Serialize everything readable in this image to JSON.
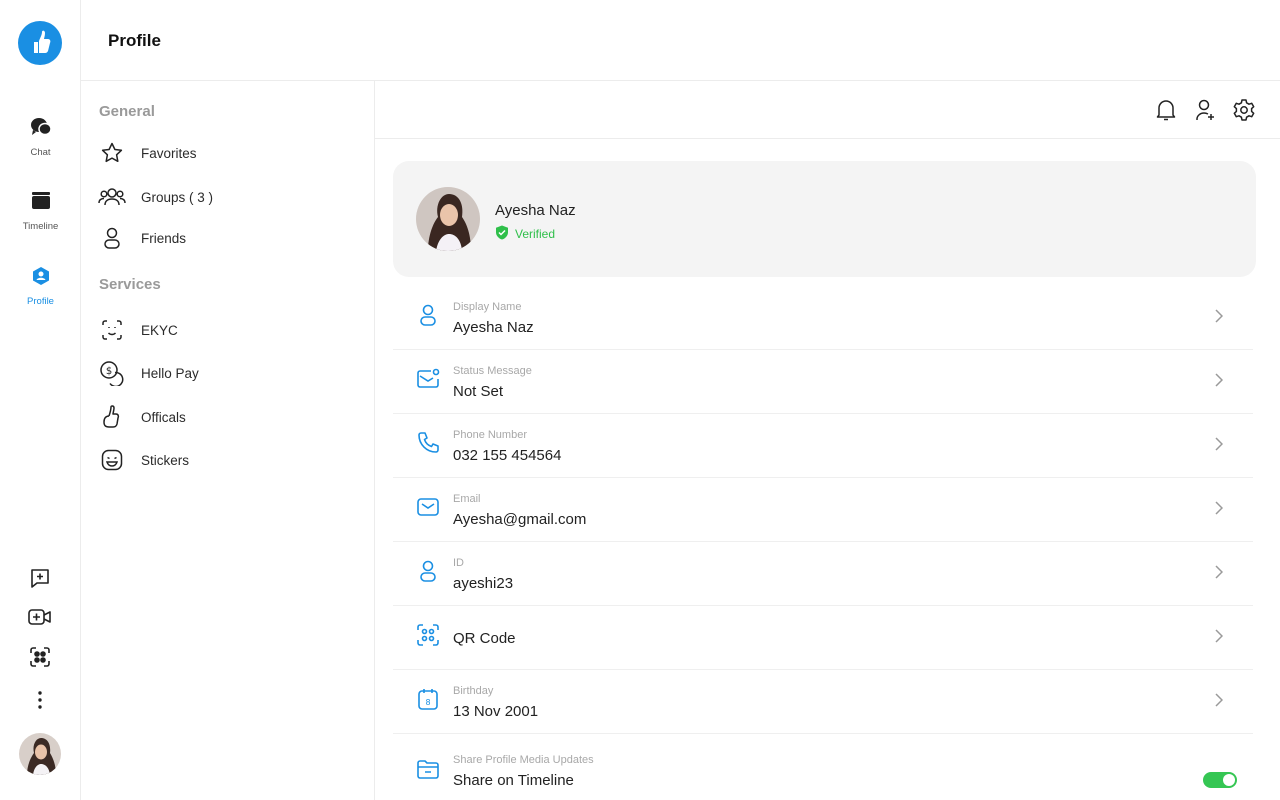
{
  "header": {
    "title": "Profile"
  },
  "rail": {
    "items": [
      {
        "label": "Chat",
        "icon": "chat-bubbles-icon"
      },
      {
        "label": "Timeline",
        "icon": "timeline-icon"
      },
      {
        "label": "Profile",
        "icon": "profile-icon",
        "active": true
      }
    ],
    "tools": [
      "add-chat-icon",
      "add-video-icon",
      "scan-icon",
      "more-vertical-icon"
    ]
  },
  "menu": {
    "general_title": "General",
    "general": [
      {
        "label": "Favorites",
        "icon": "star-icon"
      },
      {
        "label": "Groups ( 3 )",
        "icon": "groups-icon"
      },
      {
        "label": "Friends",
        "icon": "friend-icon"
      }
    ],
    "services_title": "Services",
    "services": [
      {
        "label": "EKYC",
        "icon": "face-scan-icon"
      },
      {
        "label": "Hello Pay",
        "icon": "coins-icon"
      },
      {
        "label": "Officals",
        "icon": "thumbs-up-icon"
      },
      {
        "label": "Stickers",
        "icon": "sticker-icon"
      }
    ]
  },
  "profile": {
    "name": "Ayesha Naz",
    "verified_label": "Verified"
  },
  "fields": [
    {
      "label": "Display Name",
      "value": "Ayesha Naz",
      "icon": "user-icon"
    },
    {
      "label": "Status Message",
      "value": "Not Set",
      "icon": "status-mail-icon"
    },
    {
      "label": "Phone Number",
      "value": "032 155 454564",
      "icon": "phone-icon"
    },
    {
      "label": "Email",
      "value": "Ayesha@gmail.com",
      "icon": "email-icon"
    },
    {
      "label": "ID",
      "value": "ayeshi23",
      "icon": "id-user-icon"
    },
    {
      "label": "",
      "value": "QR Code",
      "icon": "qr-code-icon"
    },
    {
      "label": "Birthday",
      "value": "13 Nov 2001",
      "icon": "calendar-icon"
    },
    {
      "label": "Share Profile Media Updates",
      "value": "Share on Timeline",
      "icon": "folder-icon",
      "toggle_on": true
    }
  ],
  "colors": {
    "accent": "#1a8fe3",
    "verified": "#2fbf4a",
    "toggle": "#35c653"
  }
}
